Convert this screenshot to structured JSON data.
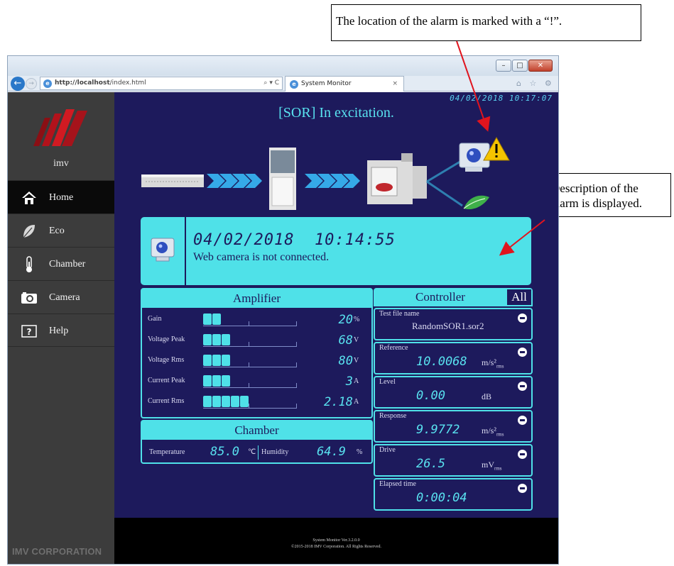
{
  "callouts": {
    "top": "The location of the alarm is marked with a “!”.",
    "right": "Description of the alarm is displayed."
  },
  "browser": {
    "url": "http://localhost/index.html",
    "url_host": "http://localhost",
    "url_path": "/index.html",
    "tab_title": "System Monitor",
    "address_controls": "⌕ ▾ C",
    "nav_icons": "⌂ ☆ ⚙"
  },
  "sidebar": {
    "brand": "imv",
    "items": [
      {
        "label": "Home",
        "icon": "home-icon",
        "active": true
      },
      {
        "label": "Eco",
        "icon": "leaf-icon"
      },
      {
        "label": "Chamber",
        "icon": "thermometer-icon"
      },
      {
        "label": "Camera",
        "icon": "camera-icon"
      },
      {
        "label": "Help",
        "icon": "help-icon"
      }
    ],
    "corporation": "IMV CORPORATION"
  },
  "header": {
    "clock": "04/02/2018 10:17:07",
    "status": "[SOR] In excitation."
  },
  "alarm": {
    "datetime": "04/02/2018  10:14:55",
    "message": "Web camera is not connected."
  },
  "amplifier": {
    "title": "Amplifier",
    "rows": [
      {
        "label": "Gain",
        "value": "20",
        "unit": "%",
        "segments": 2
      },
      {
        "label": "Voltage Peak",
        "value": "68",
        "unit": "V",
        "segments": 3
      },
      {
        "label": "Voltage Rms",
        "value": "80",
        "unit": "V",
        "segments": 3
      },
      {
        "label": "Current Peak",
        "value": "3",
        "unit": "A",
        "segments": 3
      },
      {
        "label": "Current Rms",
        "value": "2.18",
        "unit": "A",
        "segments": 5
      }
    ]
  },
  "chamber": {
    "title": "Chamber",
    "temperature_label": "Temperature",
    "temperature_value": "85.0",
    "temperature_unit": "℃",
    "humidity_label": "Humidity",
    "humidity_value": "64.9",
    "humidity_unit": "%"
  },
  "controller": {
    "title": "Controller",
    "all_label": "All",
    "items": [
      {
        "label": "Test file name",
        "text": "RandomSOR1.sor2"
      },
      {
        "label": "Reference",
        "value": "10.0068",
        "unit": "m/s²",
        "unit_sub": "rms"
      },
      {
        "label": "Level",
        "value": "0.00",
        "unit": "dB"
      },
      {
        "label": "Response",
        "value": "9.9772",
        "unit": "m/s²",
        "unit_sub": "rms"
      },
      {
        "label": "Drive",
        "value": "26.5",
        "unit": "mV",
        "unit_sub": "rms"
      },
      {
        "label": "Elapsed time",
        "value": "0:00:04"
      }
    ]
  },
  "footer": {
    "version": "System Monitor Ver.3.2.0.0",
    "copyright": "©2015-2018 IMV Corporation. All Rights Reserved."
  },
  "colors": {
    "background": "#1d1a5c",
    "accent": "#4fe1e8",
    "sidebar": "#3c3c3c",
    "alarm": "#f5c400"
  }
}
